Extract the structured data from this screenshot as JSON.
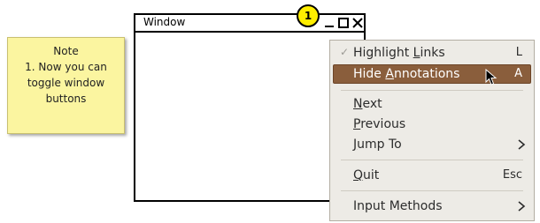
{
  "note": {
    "lines": [
      "Note",
      "1. Now you can",
      "toggle window",
      "buttons"
    ]
  },
  "window": {
    "title": "Window",
    "badge": "1",
    "buttons": [
      "minimize-icon",
      "maximize-icon",
      "close-icon"
    ]
  },
  "menu": {
    "items": [
      {
        "label": "Highlight Links",
        "mnemonic": "L",
        "shortcut": "L",
        "checked": true
      },
      {
        "label": "Hide Annotations",
        "mnemonic": "A",
        "shortcut": "A",
        "highlighted": true
      },
      {
        "label": "Next",
        "mnemonic": "N"
      },
      {
        "label": "Previous",
        "mnemonic": "P"
      },
      {
        "label": "Jump To",
        "mnemonic": "J",
        "submenu": true
      },
      {
        "label": "Quit",
        "mnemonic": "Q",
        "shortcut": "Esc"
      },
      {
        "label": "Input Methods",
        "submenu": true
      }
    ],
    "check_glyph": "✓"
  },
  "colors": {
    "note_bg": "#fbf5a0",
    "badge": "#ffee00",
    "menu_bg": "#edebe6",
    "menu_highlight": "#8a5e3c"
  }
}
